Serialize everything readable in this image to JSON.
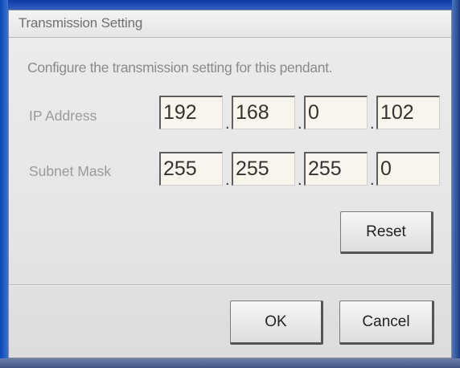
{
  "dialog": {
    "title": "Transmission Setting",
    "description": "Configure the transmission setting for this pendant."
  },
  "ip_address": {
    "label": "IP Address",
    "octets": [
      "192",
      "168",
      "0",
      "102"
    ]
  },
  "subnet_mask": {
    "label": "Subnet Mask",
    "octets": [
      "255",
      "255",
      "255",
      "0"
    ]
  },
  "separator": ".",
  "buttons": {
    "reset": "Reset",
    "ok": "OK",
    "cancel": "Cancel"
  }
}
